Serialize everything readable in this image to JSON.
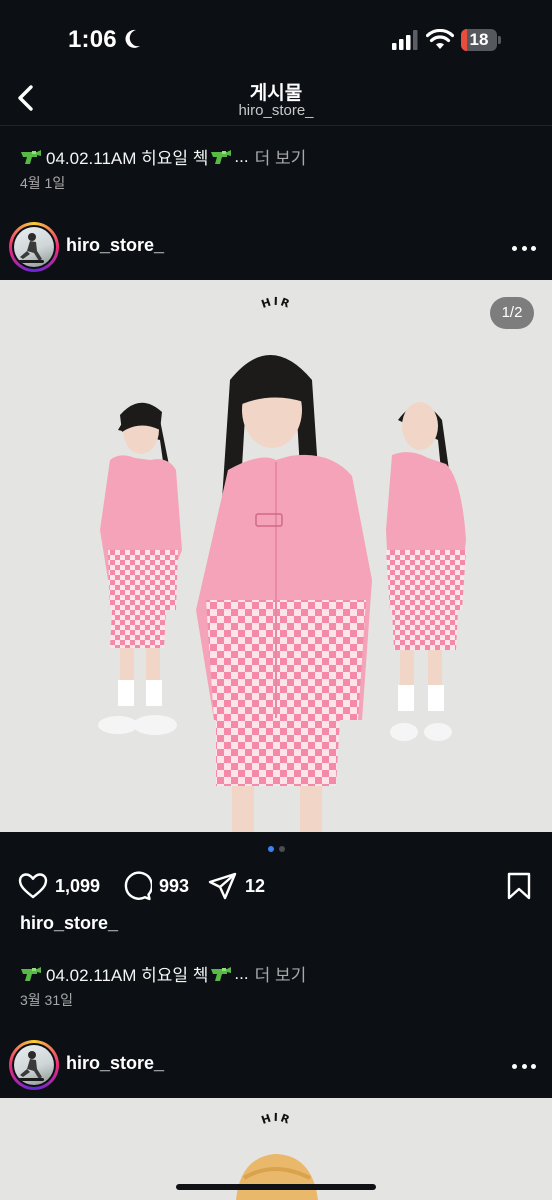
{
  "status_bar": {
    "time": "1:06",
    "battery_level": "18",
    "battery_fraction": 0.18,
    "icons": [
      "moon-icon",
      "signal-icon",
      "wifi-icon",
      "battery-icon"
    ]
  },
  "header": {
    "back_icon": "chevron-left-icon",
    "title": "게시물",
    "subtitle": "hiro_store_"
  },
  "top_caption": {
    "text": "04.02.11AM 히요일 첵",
    "ellipsis": "...",
    "more_label": "더 보기",
    "date": "4월 1일"
  },
  "post_1": {
    "username": "hiro_store_",
    "image_counter": "1/2",
    "carousel_dots": 2,
    "active_dot": 0,
    "brand_logo_text": "HIRO",
    "likes": "1,099",
    "comments": "993",
    "shares": "12",
    "author": "hiro_store_",
    "caption": "04.02.11AM 히요일 첵",
    "ellipsis": "...",
    "more_label": "더 보기",
    "date": "3월 31일"
  },
  "post_2": {
    "username": "hiro_store_",
    "brand_logo_text": "HIRO"
  },
  "colors": {
    "background": "#0c1014",
    "text": "#f5f5f5",
    "muted": "#a8a8a8",
    "accent_dot": "#3b82f6",
    "battery_red": "#eb4d3d",
    "hoodie_pink": "#f4a3b8"
  }
}
